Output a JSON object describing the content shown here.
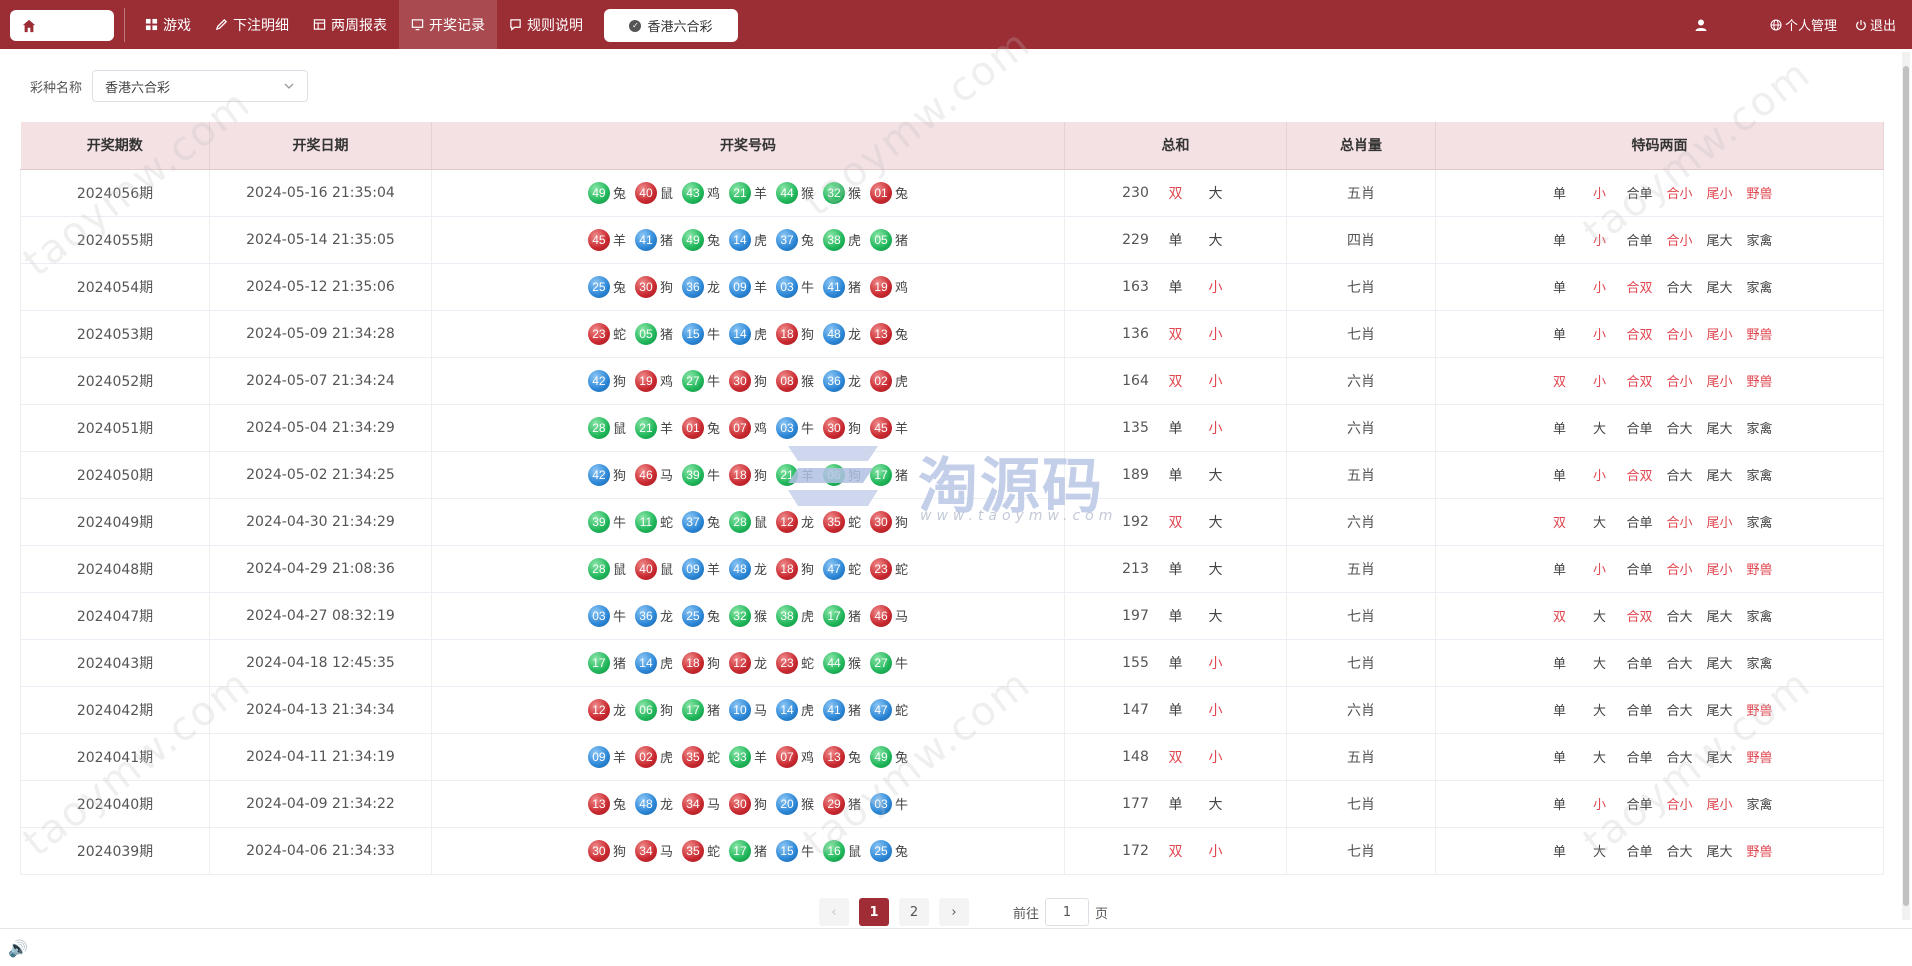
{
  "topbar": {
    "nav": [
      {
        "label": "游戏",
        "icon": "grid-icon"
      },
      {
        "label": "下注明细",
        "icon": "pen-icon"
      },
      {
        "label": "两周报表",
        "icon": "table-icon"
      },
      {
        "label": "开奖记录",
        "icon": "monitor-icon",
        "active": true
      },
      {
        "label": "规则说明",
        "icon": "chat-icon"
      }
    ],
    "lottery": "香港六合彩",
    "personal": "个人管理",
    "logout": "退出"
  },
  "filter": {
    "label": "彩种名称",
    "value": "香港六合彩"
  },
  "table": {
    "headers": [
      "开奖期数",
      "开奖日期",
      "开奖号码",
      "总和",
      "总肖量",
      "特码两面"
    ],
    "rows": [
      {
        "period": "2024056期",
        "date": "2024-05-16 21:35:04",
        "balls": [
          [
            "49",
            "green",
            "兔"
          ],
          [
            "40",
            "red",
            "鼠"
          ],
          [
            "43",
            "green",
            "鸡"
          ],
          [
            "21",
            "green",
            "羊"
          ],
          [
            "44",
            "green",
            "猴"
          ],
          [
            "32",
            "green",
            "猴"
          ],
          [
            "01",
            "red",
            "兔"
          ]
        ],
        "sum": "230",
        "oe": "双",
        "bs": "大",
        "zodiac": "五肖",
        "special": [
          "单",
          "小",
          "合单",
          "合小",
          "尾小",
          "野兽"
        ]
      },
      {
        "period": "2024055期",
        "date": "2024-05-14 21:35:05",
        "balls": [
          [
            "45",
            "red",
            "羊"
          ],
          [
            "41",
            "blue",
            "猪"
          ],
          [
            "49",
            "green",
            "兔"
          ],
          [
            "14",
            "blue",
            "虎"
          ],
          [
            "37",
            "blue",
            "兔"
          ],
          [
            "38",
            "green",
            "虎"
          ],
          [
            "05",
            "green",
            "猪"
          ]
        ],
        "sum": "229",
        "oe": "单",
        "bs": "大",
        "zodiac": "四肖",
        "special": [
          "单",
          "小",
          "合单",
          "合小",
          "尾大",
          "家禽"
        ]
      },
      {
        "period": "2024054期",
        "date": "2024-05-12 21:35:06",
        "balls": [
          [
            "25",
            "blue",
            "兔"
          ],
          [
            "30",
            "red",
            "狗"
          ],
          [
            "36",
            "blue",
            "龙"
          ],
          [
            "09",
            "blue",
            "羊"
          ],
          [
            "03",
            "blue",
            "牛"
          ],
          [
            "41",
            "blue",
            "猪"
          ],
          [
            "19",
            "red",
            "鸡"
          ]
        ],
        "sum": "163",
        "oe": "单",
        "bs": "小",
        "zodiac": "七肖",
        "special": [
          "单",
          "小",
          "合双",
          "合大",
          "尾大",
          "家禽"
        ]
      },
      {
        "period": "2024053期",
        "date": "2024-05-09 21:34:28",
        "balls": [
          [
            "23",
            "red",
            "蛇"
          ],
          [
            "05",
            "green",
            "猪"
          ],
          [
            "15",
            "blue",
            "牛"
          ],
          [
            "14",
            "blue",
            "虎"
          ],
          [
            "18",
            "red",
            "狗"
          ],
          [
            "48",
            "blue",
            "龙"
          ],
          [
            "13",
            "red",
            "兔"
          ]
        ],
        "sum": "136",
        "oe": "双",
        "bs": "小",
        "zodiac": "七肖",
        "special": [
          "单",
          "小",
          "合双",
          "合小",
          "尾小",
          "野兽"
        ]
      },
      {
        "period": "2024052期",
        "date": "2024-05-07 21:34:24",
        "balls": [
          [
            "42",
            "blue",
            "狗"
          ],
          [
            "19",
            "red",
            "鸡"
          ],
          [
            "27",
            "green",
            "牛"
          ],
          [
            "30",
            "red",
            "狗"
          ],
          [
            "08",
            "red",
            "猴"
          ],
          [
            "36",
            "blue",
            "龙"
          ],
          [
            "02",
            "red",
            "虎"
          ]
        ],
        "sum": "164",
        "oe": "双",
        "bs": "小",
        "zodiac": "六肖",
        "special": [
          "双",
          "小",
          "合双",
          "合小",
          "尾小",
          "野兽"
        ]
      },
      {
        "period": "2024051期",
        "date": "2024-05-04 21:34:29",
        "balls": [
          [
            "28",
            "green",
            "鼠"
          ],
          [
            "21",
            "green",
            "羊"
          ],
          [
            "01",
            "red",
            "兔"
          ],
          [
            "07",
            "red",
            "鸡"
          ],
          [
            "03",
            "blue",
            "牛"
          ],
          [
            "30",
            "red",
            "狗"
          ],
          [
            "45",
            "red",
            "羊"
          ]
        ],
        "sum": "135",
        "oe": "单",
        "bs": "小",
        "zodiac": "六肖",
        "special": [
          "单",
          "大",
          "合单",
          "合大",
          "尾大",
          "家禽"
        ]
      },
      {
        "period": "2024050期",
        "date": "2024-05-02 21:34:25",
        "balls": [
          [
            "42",
            "blue",
            "狗"
          ],
          [
            "46",
            "red",
            "马"
          ],
          [
            "39",
            "green",
            "牛"
          ],
          [
            "18",
            "red",
            "狗"
          ],
          [
            "21",
            "green",
            "羊"
          ],
          [
            "06",
            "green",
            "狗"
          ],
          [
            "17",
            "green",
            "猪"
          ]
        ],
        "sum": "189",
        "oe": "单",
        "bs": "大",
        "zodiac": "五肖",
        "special": [
          "单",
          "小",
          "合双",
          "合大",
          "尾大",
          "家禽"
        ]
      },
      {
        "period": "2024049期",
        "date": "2024-04-30 21:34:29",
        "balls": [
          [
            "39",
            "green",
            "牛"
          ],
          [
            "11",
            "green",
            "蛇"
          ],
          [
            "37",
            "blue",
            "兔"
          ],
          [
            "28",
            "green",
            "鼠"
          ],
          [
            "12",
            "red",
            "龙"
          ],
          [
            "35",
            "red",
            "蛇"
          ],
          [
            "30",
            "red",
            "狗"
          ]
        ],
        "sum": "192",
        "oe": "双",
        "bs": "大",
        "zodiac": "六肖",
        "special": [
          "双",
          "大",
          "合单",
          "合小",
          "尾小",
          "家禽"
        ]
      },
      {
        "period": "2024048期",
        "date": "2024-04-29 21:08:36",
        "balls": [
          [
            "28",
            "green",
            "鼠"
          ],
          [
            "40",
            "red",
            "鼠"
          ],
          [
            "09",
            "blue",
            "羊"
          ],
          [
            "48",
            "blue",
            "龙"
          ],
          [
            "18",
            "red",
            "狗"
          ],
          [
            "47",
            "blue",
            "蛇"
          ],
          [
            "23",
            "red",
            "蛇"
          ]
        ],
        "sum": "213",
        "oe": "单",
        "bs": "大",
        "zodiac": "五肖",
        "special": [
          "单",
          "小",
          "合单",
          "合小",
          "尾小",
          "野兽"
        ]
      },
      {
        "period": "2024047期",
        "date": "2024-04-27 08:32:19",
        "balls": [
          [
            "03",
            "blue",
            "牛"
          ],
          [
            "36",
            "blue",
            "龙"
          ],
          [
            "25",
            "blue",
            "兔"
          ],
          [
            "32",
            "green",
            "猴"
          ],
          [
            "38",
            "green",
            "虎"
          ],
          [
            "17",
            "green",
            "猪"
          ],
          [
            "46",
            "red",
            "马"
          ]
        ],
        "sum": "197",
        "oe": "单",
        "bs": "大",
        "zodiac": "七肖",
        "special": [
          "双",
          "大",
          "合双",
          "合大",
          "尾大",
          "家禽"
        ]
      },
      {
        "period": "2024043期",
        "date": "2024-04-18 12:45:35",
        "balls": [
          [
            "17",
            "green",
            "猪"
          ],
          [
            "14",
            "blue",
            "虎"
          ],
          [
            "18",
            "red",
            "狗"
          ],
          [
            "12",
            "red",
            "龙"
          ],
          [
            "23",
            "red",
            "蛇"
          ],
          [
            "44",
            "green",
            "猴"
          ],
          [
            "27",
            "green",
            "牛"
          ]
        ],
        "sum": "155",
        "oe": "单",
        "bs": "小",
        "zodiac": "七肖",
        "special": [
          "单",
          "大",
          "合单",
          "合大",
          "尾大",
          "家禽"
        ]
      },
      {
        "period": "2024042期",
        "date": "2024-04-13 21:34:34",
        "balls": [
          [
            "12",
            "red",
            "龙"
          ],
          [
            "06",
            "green",
            "狗"
          ],
          [
            "17",
            "green",
            "猪"
          ],
          [
            "10",
            "blue",
            "马"
          ],
          [
            "14",
            "blue",
            "虎"
          ],
          [
            "41",
            "blue",
            "猪"
          ],
          [
            "47",
            "blue",
            "蛇"
          ]
        ],
        "sum": "147",
        "oe": "单",
        "bs": "小",
        "zodiac": "六肖",
        "special": [
          "单",
          "大",
          "合单",
          "合大",
          "尾大",
          "野兽"
        ]
      },
      {
        "period": "2024041期",
        "date": "2024-04-11 21:34:19",
        "balls": [
          [
            "09",
            "blue",
            "羊"
          ],
          [
            "02",
            "red",
            "虎"
          ],
          [
            "35",
            "red",
            "蛇"
          ],
          [
            "33",
            "green",
            "羊"
          ],
          [
            "07",
            "red",
            "鸡"
          ],
          [
            "13",
            "red",
            "兔"
          ],
          [
            "49",
            "green",
            "兔"
          ]
        ],
        "sum": "148",
        "oe": "双",
        "bs": "小",
        "zodiac": "五肖",
        "special": [
          "单",
          "大",
          "合单",
          "合大",
          "尾大",
          "野兽"
        ]
      },
      {
        "period": "2024040期",
        "date": "2024-04-09 21:34:22",
        "balls": [
          [
            "13",
            "red",
            "兔"
          ],
          [
            "48",
            "blue",
            "龙"
          ],
          [
            "34",
            "red",
            "马"
          ],
          [
            "30",
            "red",
            "狗"
          ],
          [
            "20",
            "blue",
            "猴"
          ],
          [
            "29",
            "red",
            "猪"
          ],
          [
            "03",
            "blue",
            "牛"
          ]
        ],
        "sum": "177",
        "oe": "单",
        "bs": "大",
        "zodiac": "七肖",
        "special": [
          "单",
          "小",
          "合单",
          "合小",
          "尾小",
          "家禽"
        ]
      },
      {
        "period": "2024039期",
        "date": "2024-04-06 21:34:33",
        "balls": [
          [
            "30",
            "red",
            "狗"
          ],
          [
            "34",
            "red",
            "马"
          ],
          [
            "35",
            "red",
            "蛇"
          ],
          [
            "17",
            "green",
            "猪"
          ],
          [
            "15",
            "blue",
            "牛"
          ],
          [
            "16",
            "green",
            "鼠"
          ],
          [
            "25",
            "blue",
            "兔"
          ]
        ],
        "sum": "172",
        "oe": "双",
        "bs": "小",
        "zodiac": "七肖",
        "special": [
          "单",
          "大",
          "合单",
          "合大",
          "尾大",
          "野兽"
        ]
      }
    ]
  },
  "pagination": {
    "pages": [
      "1",
      "2"
    ],
    "current": "1",
    "goto_label": "前往",
    "goto_value": "1",
    "page_suffix": "页"
  },
  "watermark": {
    "brand": "淘源码",
    "url": "www.taoymw.com",
    "diagonal": "taoymw.com"
  },
  "colors": {
    "header_bg": "#9b2d35",
    "accent_red": "#e0464f",
    "table_header_bg": "#f3e1e3"
  }
}
